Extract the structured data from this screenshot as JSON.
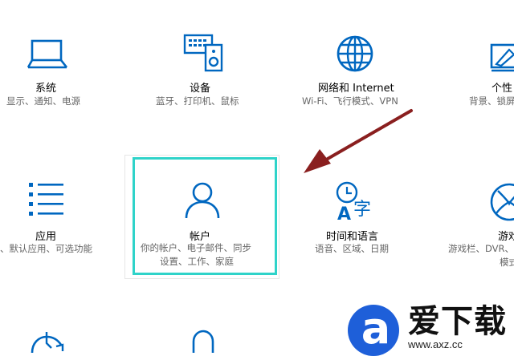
{
  "accent": "#0067c0",
  "tiles": [
    {
      "title": "系统",
      "sub1": "显示、通知、电源",
      "icon": "laptop-icon"
    },
    {
      "title": "设备",
      "sub1": "蓝牙、打印机、鼠标",
      "icon": "devices-icon"
    },
    {
      "title": "网络和 Internet",
      "sub1": "Wi-Fi、飞行模式、VPN",
      "icon": "globe-icon"
    },
    {
      "title": "个性",
      "sub1": "背景、锁屏",
      "icon": "personalization-icon"
    },
    {
      "title": "应用",
      "sub1": "、默认应用、可选功能",
      "icon": "apps-list-icon"
    },
    {
      "title": "帐户",
      "sub1": "你的帐户、电子邮件、同步",
      "sub2": "设置、工作、家庭",
      "icon": "person-icon"
    },
    {
      "title": "时间和语言",
      "sub1": "语音、区域、日期",
      "icon": "time-language-icon"
    },
    {
      "title": "游戏",
      "sub1": "游戏栏、DVR、",
      "sub2": "模式",
      "icon": "xbox-icon"
    }
  ],
  "watermark": {
    "name": "爱下载",
    "url": "www.axz.cc"
  }
}
